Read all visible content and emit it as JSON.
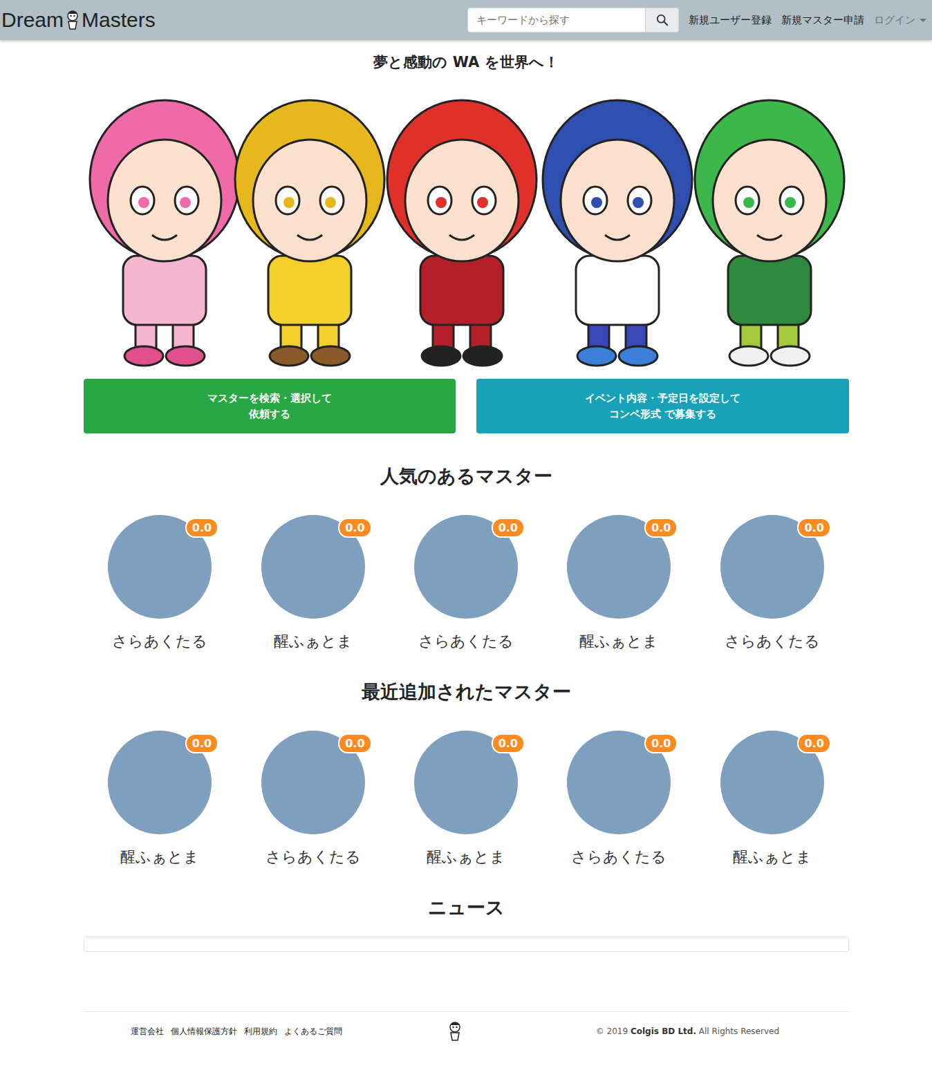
{
  "navbar": {
    "logo": {
      "left": "Dream",
      "right": "Masters"
    },
    "search": {
      "placeholder": "キーワードから探す"
    },
    "links": [
      "新規ユーザー登録",
      "新規マスター申請"
    ],
    "login": "ログイン"
  },
  "tagline": "夢と感動の WA を世界へ！",
  "actions": [
    {
      "lines": [
        "マスターを検索・選択して",
        "依頼する"
      ],
      "color": "#28a745"
    },
    {
      "lines": [
        "イベント内容・予定日を設定して",
        "コンペ形式 で募集する"
      ],
      "color": "#17a2b8"
    }
  ],
  "sections": [
    {
      "title": "人気のあるマスター",
      "masters": [
        {
          "name": "さらあくたる",
          "rating": "0.0"
        },
        {
          "name": "醒ふぁとま",
          "rating": "0.0"
        },
        {
          "name": "さらあくたる",
          "rating": "0.0"
        },
        {
          "name": "醒ふぁとま",
          "rating": "0.0"
        },
        {
          "name": "さらあくたる",
          "rating": "0.0"
        }
      ]
    },
    {
      "title": "最近追加されたマスター",
      "masters": [
        {
          "name": "醒ふぁとま",
          "rating": "0.0"
        },
        {
          "name": "さらあくたる",
          "rating": "0.0"
        },
        {
          "name": "醒ふぁとま",
          "rating": "0.0"
        },
        {
          "name": "さらあくたる",
          "rating": "0.0"
        },
        {
          "name": "醒ふぁとま",
          "rating": "0.0"
        }
      ]
    }
  ],
  "news": {
    "title": "ニュース"
  },
  "footer": {
    "links": [
      "運営会社",
      "個人情報保護方針",
      "利用規約",
      "よくあるご質問"
    ],
    "copyright": {
      "prefix": "© 2019 ",
      "company": "Colgis BD Ltd.",
      "suffix": " All Rights Reserved"
    }
  }
}
